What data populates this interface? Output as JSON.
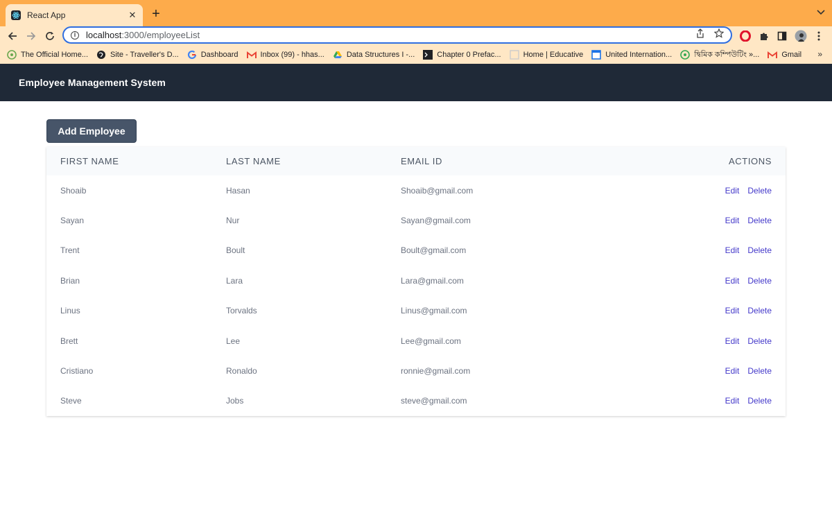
{
  "browser": {
    "tab_title": "React App",
    "tab_close": "✕",
    "new_tab": "+",
    "url_host": "localhost",
    "url_path": ":3000/employeeList",
    "bookmarks": [
      {
        "label": "The Official Home...",
        "icon": "site-icon",
        "color": "#6aa84f"
      },
      {
        "label": "Site - Traveller's D...",
        "icon": "globe-icon",
        "color": "#202124"
      },
      {
        "label": "Dashboard",
        "icon": "google-icon",
        "color": "#4285f4"
      },
      {
        "label": "Inbox (99) - hhas...",
        "icon": "gmail-icon",
        "color": "#ea4335"
      },
      {
        "label": "Data Structures I -...",
        "icon": "drive-icon",
        "color": "#34a853"
      },
      {
        "label": "Chapter 0   Prefac...",
        "icon": "terminal-icon",
        "color": "#202124"
      },
      {
        "label": "Home | Educative",
        "icon": "page-icon",
        "color": "#cccccc"
      },
      {
        "label": "United Internation...",
        "icon": "calendar-icon",
        "color": "#1a73e8"
      },
      {
        "label": "দ্বিমিক কম্পিউটিং »...",
        "icon": "site-icon",
        "color": "#34a853"
      },
      {
        "label": "Gmail",
        "icon": "gmail-icon",
        "color": "#ea4335"
      }
    ],
    "bookmarks_more": "»"
  },
  "app": {
    "title": "Employee Management System",
    "add_button": "Add Employee"
  },
  "table": {
    "headers": [
      "First Name",
      "Last Name",
      "Email Id",
      "Actions"
    ],
    "action_edit": "Edit",
    "action_delete": "Delete",
    "rows": [
      {
        "first": "Shoaib",
        "last": "Hasan",
        "email": "Shoaib@gmail.com"
      },
      {
        "first": "Sayan",
        "last": "Nur",
        "email": "Sayan@gmail.com"
      },
      {
        "first": "Trent",
        "last": "Boult",
        "email": "Boult@gmail.com"
      },
      {
        "first": "Brian",
        "last": "Lara",
        "email": "Lara@gmail.com"
      },
      {
        "first": "Linus",
        "last": "Torvalds",
        "email": "Linus@gmail.com"
      },
      {
        "first": "Brett",
        "last": "Lee",
        "email": "Lee@gmail.com"
      },
      {
        "first": "Cristiano",
        "last": "Ronaldo",
        "email": "ronnie@gmail.com"
      },
      {
        "first": "Steve",
        "last": "Jobs",
        "email": "steve@gmail.com"
      }
    ]
  },
  "colors": {
    "tab_strip": "#fdab4b",
    "header_bg": "#1f2937",
    "button_bg": "#475569",
    "action_link": "#4338ca"
  }
}
